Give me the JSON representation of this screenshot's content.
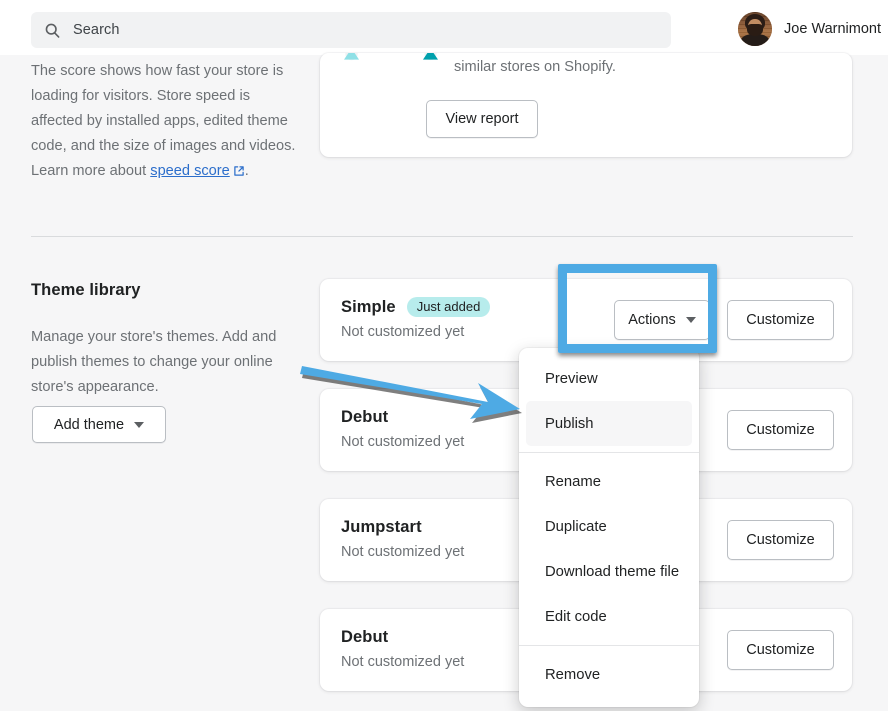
{
  "header": {
    "search": {
      "placeholder": "Search",
      "value": "",
      "icon": "search-icon"
    },
    "account": {
      "name": "Joe Warnimont",
      "avatar_alt": "Joe Warnimont profile photo"
    }
  },
  "speed_section": {
    "description_parts": {
      "before_link": "The score shows how fast your store is loading for visitors. Store speed is affected by installed apps, edited theme code, and the size of images and videos. Learn more about ",
      "link_text": "speed score",
      "link_icon": "external-link-icon",
      "after_link": "."
    },
    "card": {
      "text": "similar stores on Shopify.",
      "view_report_label": "View report",
      "gauge_accent": "#00a0ac",
      "gauge_accent_light": "#8fe0e6",
      "gauge_track": "#f1f2f3"
    }
  },
  "theme_library": {
    "title": "Theme library",
    "description": "Manage your store's themes. Add and publish themes to change your online store's appearance.",
    "add_theme_label": "Add theme",
    "actions_label": "Actions",
    "customize_label": "Customize",
    "not_customized_label": "Not customized yet",
    "themes": [
      {
        "name": "Simple",
        "badge": "Just added",
        "subtitle": "Not customized yet",
        "has_actions": true,
        "customize": "Customize"
      },
      {
        "name": "Debut",
        "badge": "",
        "subtitle": "Not customized yet",
        "has_actions": false,
        "customize": "Customize"
      },
      {
        "name": "Jumpstart",
        "badge": "",
        "subtitle": "Not customized yet",
        "has_actions": false,
        "customize": "Customize"
      },
      {
        "name": "Debut",
        "badge": "",
        "subtitle": "Not customized yet",
        "has_actions": false,
        "customize": "Customize"
      }
    ]
  },
  "dropdown_menu": {
    "open": true,
    "items": [
      {
        "label": "Preview",
        "highlighted": false,
        "separator_after": false
      },
      {
        "label": "Publish",
        "highlighted": true,
        "separator_after": true
      },
      {
        "label": "Rename",
        "highlighted": false,
        "separator_after": false
      },
      {
        "label": "Duplicate",
        "highlighted": false,
        "separator_after": false
      },
      {
        "label": "Download theme file",
        "highlighted": false,
        "separator_after": false
      },
      {
        "label": "Edit code",
        "highlighted": false,
        "separator_after": true
      },
      {
        "label": "Remove",
        "highlighted": false,
        "separator_after": false
      }
    ]
  },
  "annotations": {
    "highlight_box": {
      "target": "actions-button",
      "color": "#4eaae4"
    },
    "arrow": {
      "points_to": "publish-menu-item",
      "color": "#4eaae4"
    }
  },
  "colors": {
    "page_background": "#f6f6f7",
    "card_background": "#ffffff",
    "text_primary": "#202223",
    "text_secondary": "#6d7175",
    "link": "#2c6ecb",
    "badge_background": "#b7ecec",
    "annotation_blue": "#4eaae4"
  }
}
